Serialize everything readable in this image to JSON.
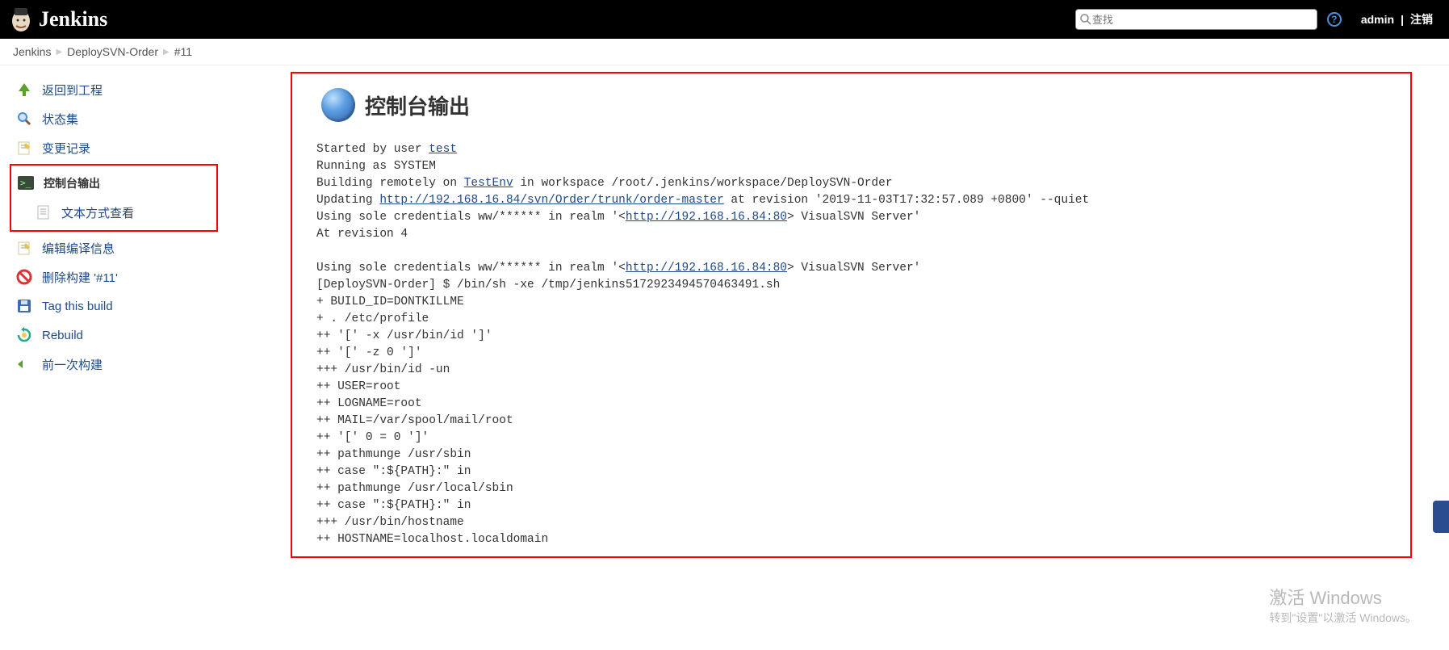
{
  "header": {
    "app_name": "Jenkins",
    "search_placeholder": "查找",
    "user": "admin",
    "logout": "注销"
  },
  "breadcrumb": {
    "items": [
      "Jenkins",
      "DeploySVN-Order",
      "#11"
    ]
  },
  "sidebar": {
    "back": "返回到工程",
    "status": "状态集",
    "changes": "变更记录",
    "console": "控制台输出",
    "console_text": "文本方式查看",
    "edit": "编辑编译信息",
    "delete": "删除构建 '#11'",
    "tag": "Tag this build",
    "rebuild": "Rebuild",
    "prev": "前一次构建"
  },
  "main": {
    "title": "控制台输出",
    "console_segments": [
      {
        "t": "Started by user "
      },
      {
        "t": "test",
        "link": true
      },
      {
        "t": "\nRunning as SYSTEM\nBuilding remotely on "
      },
      {
        "t": "TestEnv",
        "link": true
      },
      {
        "t": " in workspace /root/.jenkins/workspace/DeploySVN-Order\nUpdating "
      },
      {
        "t": "http://192.168.16.84/svn/Order/trunk/order-master",
        "link": true
      },
      {
        "t": " at revision '2019-11-03T17:32:57.089 +0800' --quiet\nUsing sole credentials ww/****** in realm '<"
      },
      {
        "t": "http://192.168.16.84:80",
        "link": true
      },
      {
        "t": "> VisualSVN Server'\nAt revision 4\n\nUsing sole credentials ww/****** in realm '<"
      },
      {
        "t": "http://192.168.16.84:80",
        "link": true
      },
      {
        "t": "> VisualSVN Server'\n[DeploySVN-Order] $ /bin/sh -xe /tmp/jenkins5172923494570463491.sh\n+ BUILD_ID=DONTKILLME\n+ . /etc/profile\n++ '[' -x /usr/bin/id ']'\n++ '[' -z 0 ']'\n+++ /usr/bin/id -un\n++ USER=root\n++ LOGNAME=root\n++ MAIL=/var/spool/mail/root\n++ '[' 0 = 0 ']'\n++ pathmunge /usr/sbin\n++ case \":${PATH}:\" in\n++ pathmunge /usr/local/sbin\n++ case \":${PATH}:\" in\n+++ /usr/bin/hostname\n++ HOSTNAME=localhost.localdomain\n"
      }
    ]
  },
  "watermark": {
    "l1": "激活 Windows",
    "l2": "转到\"设置\"以激活 Windows。"
  }
}
